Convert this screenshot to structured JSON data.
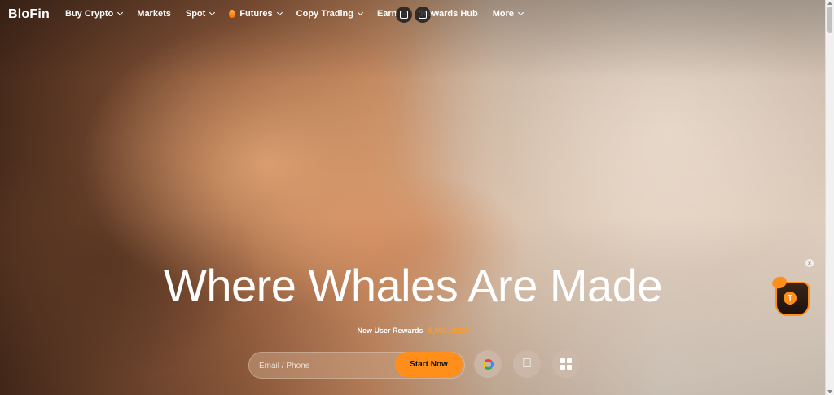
{
  "brand": {
    "logo_text": "BloFin"
  },
  "nav": {
    "items": [
      {
        "label": "Buy Crypto",
        "has_dropdown": true
      },
      {
        "label": "Markets",
        "has_dropdown": false
      },
      {
        "label": "Spot",
        "has_dropdown": true
      },
      {
        "label": "Futures",
        "has_dropdown": true,
        "icon": "fire-icon"
      },
      {
        "label": "Copy Trading",
        "has_dropdown": true
      },
      {
        "label": "Earn",
        "has_dropdown": true
      },
      {
        "label": "Rewards Hub",
        "has_dropdown": false
      },
      {
        "label": "More",
        "has_dropdown": true
      }
    ]
  },
  "hero": {
    "headline": "Where Whales Are Made",
    "rewards_label": "New User Rewards",
    "rewards_amount": "5,000 USDT"
  },
  "signup": {
    "email_placeholder": "Email / Phone",
    "start_label": "Start Now",
    "social": [
      "google-icon",
      "apple-icon",
      "qr-code-icon"
    ]
  },
  "widget": {
    "coin_letter": "T",
    "close_symbol": "×"
  },
  "colors": {
    "accent": "#ff8f1a",
    "text": "#ffffff"
  }
}
